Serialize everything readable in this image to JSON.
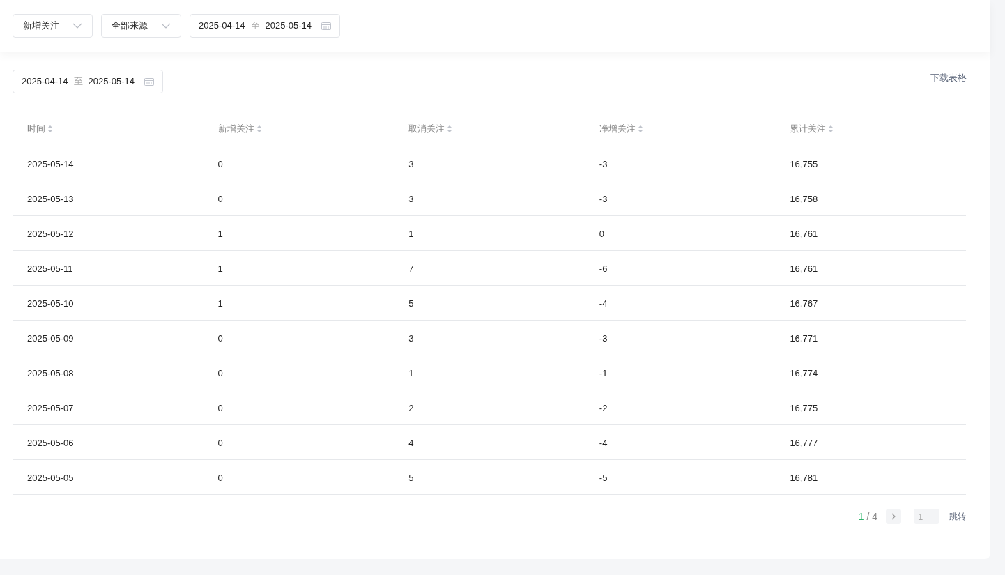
{
  "filters": {
    "metric_select": "新增关注",
    "source_select": "全部来源",
    "date_range": {
      "start": "2025-04-14",
      "separator": "至",
      "end": "2025-05-14"
    }
  },
  "table_date_range": {
    "start": "2025-04-14",
    "separator": "至",
    "end": "2025-05-14"
  },
  "download_link": "下载表格",
  "table": {
    "columns": [
      "时间",
      "新增关注",
      "取消关注",
      "净增关注",
      "累计关注"
    ],
    "rows": [
      [
        "2025-05-14",
        "0",
        "3",
        "-3",
        "16,755"
      ],
      [
        "2025-05-13",
        "0",
        "3",
        "-3",
        "16,758"
      ],
      [
        "2025-05-12",
        "1",
        "1",
        "0",
        "16,761"
      ],
      [
        "2025-05-11",
        "1",
        "7",
        "-6",
        "16,761"
      ],
      [
        "2025-05-10",
        "1",
        "5",
        "-4",
        "16,767"
      ],
      [
        "2025-05-09",
        "0",
        "3",
        "-3",
        "16,771"
      ],
      [
        "2025-05-08",
        "0",
        "1",
        "-1",
        "16,774"
      ],
      [
        "2025-05-07",
        "0",
        "2",
        "-2",
        "16,775"
      ],
      [
        "2025-05-06",
        "0",
        "4",
        "-4",
        "16,777"
      ],
      [
        "2025-05-05",
        "0",
        "5",
        "-5",
        "16,781"
      ]
    ]
  },
  "pagination": {
    "current": "1",
    "separator": "/",
    "total": "4",
    "page_input": "1",
    "jump": "跳转"
  }
}
